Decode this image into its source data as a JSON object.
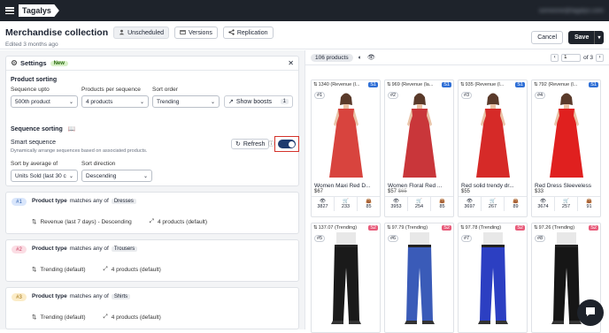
{
  "app": {
    "logo": "Tagalys",
    "user_email": "someone@tagalys.com"
  },
  "header": {
    "title": "Merchandise collection",
    "status": "Unscheduled",
    "versions": "Versions",
    "replication": "Replication",
    "subtitle": "Edited 3 months ago",
    "cancel": "Cancel",
    "save": "Save"
  },
  "settings": {
    "title": "Settings",
    "badge": "New",
    "product_sorting": "Product sorting",
    "sequence_upto_label": "Sequence upto",
    "sequence_upto_value": "500th product",
    "per_sequence_label": "Products per sequence",
    "per_sequence_value": "4 products",
    "sort_order_label": "Sort order",
    "sort_order_value": "Trending",
    "show_boosts": "Show boosts",
    "boosts_count": "1",
    "sequence_sorting": "Sequence sorting",
    "smart_sequence": "Smart sequence",
    "refresh": "Refresh",
    "smart_desc": "Dynamically arrange sequences based on associated products.",
    "sort_by_avg_label": "Sort by average of",
    "sort_by_avg_value": "Units Sold (last 30 c",
    "sort_dir_label": "Sort direction",
    "sort_dir_value": "Descending",
    "smart_enabled": true
  },
  "rules": [
    {
      "num": "#1",
      "num_bg": "#d9e6fb",
      "num_color": "#2f5fb0",
      "label": "Product type",
      "matches": "matches any of",
      "value": "Dresses",
      "sort": "Revenue (last 7 days) - Descending",
      "count": "4 products (default)"
    },
    {
      "num": "#2",
      "num_bg": "#fbdde4",
      "num_color": "#c83a5b",
      "label": "Product type",
      "matches": "matches any of",
      "value": "Trousers",
      "sort": "Trending (default)",
      "count": "4 products (default)"
    },
    {
      "num": "#3",
      "num_bg": "#fbecc8",
      "num_color": "#a1700d",
      "label": "Product type",
      "matches": "matches any of",
      "value": "Shirts",
      "sort": "Trending (default)",
      "count": "4 products (default)"
    }
  ],
  "products_panel": {
    "count_label": "106 products",
    "page": "1",
    "of_pages": "of 3"
  },
  "products": [
    {
      "metric": "1340 (Revenue (l...",
      "stag": "S1",
      "rank": "#1",
      "name": "Women Maxi Red D...",
      "price": "$67",
      "old_price": "",
      "views": "3827",
      "carts": "233",
      "buys": "85",
      "color": "#d8443e"
    },
    {
      "metric": "969 (Revenue (la...",
      "stag": "S1",
      "rank": "#2",
      "name": "Women Floral Red ...",
      "price": "$57",
      "old_price": "$65",
      "views": "3953",
      "carts": "254",
      "buys": "85",
      "color": "#c9363a"
    },
    {
      "metric": "935 (Revenue (l...",
      "stag": "S1",
      "rank": "#3",
      "name": "Red solid trendy dr...",
      "price": "$55",
      "old_price": "",
      "views": "3697",
      "carts": "267",
      "buys": "89",
      "color": "#d62a28"
    },
    {
      "metric": "792 (Revenue (l...",
      "stag": "S1",
      "rank": "#4",
      "name": "Red Dress Sleeveless",
      "price": "$33",
      "old_price": "",
      "views": "3674",
      "carts": "257",
      "buys": "91",
      "color": "#e0201f"
    },
    {
      "metric": "137.07 (Trending)",
      "stag": "S2",
      "rank": "#5",
      "name": "",
      "price": "",
      "old_price": "",
      "views": "",
      "carts": "",
      "buys": "",
      "color": "#1a1a1a"
    },
    {
      "metric": "97.79 (Trending)",
      "stag": "S2",
      "rank": "#6",
      "name": "",
      "price": "",
      "old_price": "",
      "views": "",
      "carts": "",
      "buys": "",
      "color": "#3a5bb8"
    },
    {
      "metric": "97.78 (Trending)",
      "stag": "S2",
      "rank": "#7",
      "name": "",
      "price": "",
      "old_price": "",
      "views": "",
      "carts": "",
      "buys": "",
      "color": "#2c3fc2"
    },
    {
      "metric": "97.26 (Trending)",
      "stag": "S2",
      "rank": "#8",
      "name": "",
      "price": "",
      "old_price": "",
      "views": "",
      "carts": "",
      "buys": "",
      "color": "#161616"
    }
  ]
}
